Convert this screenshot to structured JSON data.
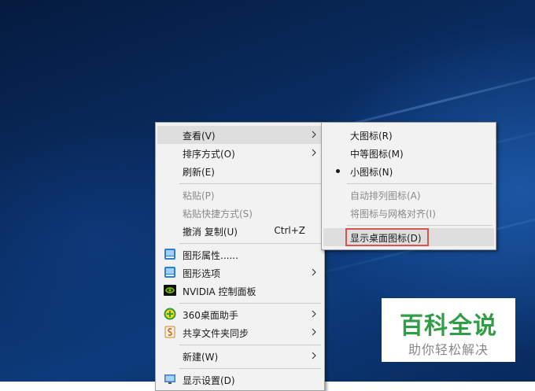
{
  "context_menu": {
    "items": [
      {
        "label": "查看(V)",
        "has_submenu": true,
        "highlighted": true
      },
      {
        "label": "排序方式(O)",
        "has_submenu": true
      },
      {
        "label": "刷新(E)"
      },
      {
        "label": "粘贴(P)",
        "disabled": true
      },
      {
        "label": "粘贴快捷方式(S)",
        "disabled": true
      },
      {
        "label": "撤消 复制(U)",
        "shortcut": "Ctrl+Z"
      },
      {
        "label": "图形属性......",
        "icon": "graphics-icon"
      },
      {
        "label": "图形选项",
        "icon": "graphics-icon",
        "has_submenu": true
      },
      {
        "label": "NVIDIA 控制面板",
        "icon": "nvidia-icon"
      },
      {
        "label": "360桌面助手",
        "icon": "360-icon",
        "has_submenu": true
      },
      {
        "label": "共享文件夹同步",
        "icon": "sync-icon",
        "has_submenu": true
      },
      {
        "label": "新建(W)",
        "has_submenu": true
      },
      {
        "label": "显示设置(D)",
        "icon": "display-icon"
      }
    ]
  },
  "view_submenu": {
    "items": [
      {
        "label": "大图标(R)"
      },
      {
        "label": "中等图标(M)"
      },
      {
        "label": "小图标(N)",
        "selected": true
      },
      {
        "label": "自动排列图标(A)",
        "disabled": true
      },
      {
        "label": "将图标与网格对齐(I)",
        "disabled": true
      },
      {
        "label": "显示桌面图标(D)",
        "highlighted": true,
        "outlined": true
      }
    ]
  },
  "watermark": {
    "title": "百科全说",
    "subtitle": "助你轻松解决"
  },
  "colors": {
    "menu_bg": "#f2f2f2",
    "highlight_bg": "#dedede",
    "annotation_red": "#d9534f",
    "watermark_green": "#2f9e44"
  }
}
